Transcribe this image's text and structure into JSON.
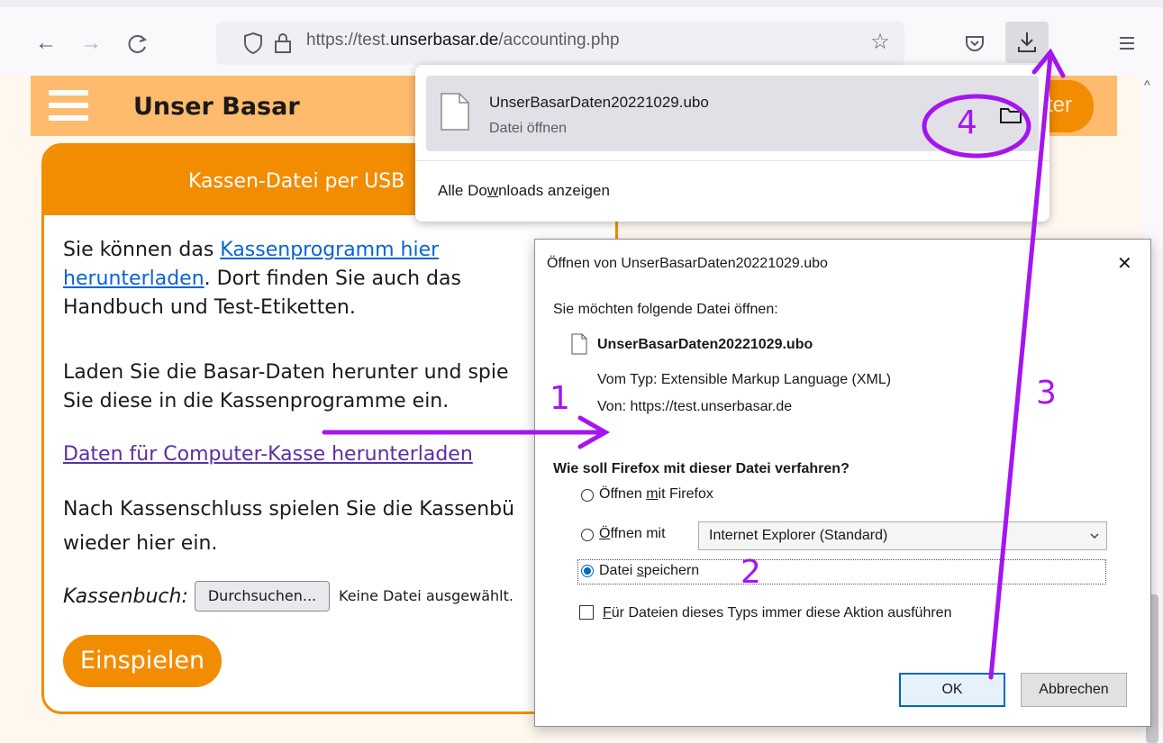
{
  "browser": {
    "url_prefix": "https://test.",
    "url_domain": "unserbasar.de",
    "url_path": "/accounting.php"
  },
  "site": {
    "title": "Unser Basar",
    "login_fragment": "ter"
  },
  "card": {
    "header": "Kassen-Datei per USB",
    "p1_a": "Sie können das ",
    "p1_link_a": "Kassenprogramm hier",
    "p1_link_b": "herunterladen",
    "p1_b": ". Dort finden Sie auch das",
    "p1_c": "Handbuch und Test-Etiketten.",
    "p2_a": "Laden Sie die Basar-Daten herunter und spie",
    "p2_b": "Sie diese in die Kassenprogramme ein.",
    "download_link": "Daten für Computer-Kasse herunterladen",
    "p3_a": "Nach Kassenschluss spielen Sie die Kassenbü",
    "p3_b": "wieder hier ein.",
    "kassenbuch_label": "Kassenbuch:",
    "browse_button": "Durchsuchen...",
    "no_file": "Keine Datei ausgewählt.",
    "import_button": "Einspielen"
  },
  "downloads_panel": {
    "filename": "UnserBasarDaten20221029.ubo",
    "status": "Datei öffnen",
    "show_all_a": "Alle Do",
    "show_all_u": "w",
    "show_all_b": "nloads anzeigen"
  },
  "dialog": {
    "title": "Öffnen von UnserBasarDaten20221029.ubo",
    "intro": "Sie möchten folgende Datei öffnen:",
    "filename": "UnserBasarDaten20221029.ubo",
    "type_label": "Vom Typ:",
    "type_value": "Extensible Markup Language (XML)",
    "from_label": "Von:",
    "from_value": "https://test.unserbasar.de",
    "question": "Wie soll Firefox mit dieser Datei verfahren?",
    "opt1_a": "Öffnen ",
    "opt1_u": "m",
    "opt1_b": "it Firefox",
    "opt2_u": "Ö",
    "opt2_b": "ffnen mit",
    "opt2_select": "Internet Explorer (Standard)",
    "opt3_a": "Datei ",
    "opt3_u": "s",
    "opt3_b": "peichern",
    "always_u": "F",
    "always_b": "ür Dateien dieses Typs immer diese Aktion ausführen",
    "ok": "OK",
    "cancel": "Abbrechen",
    "close_glyph": "✕"
  },
  "annotations": {
    "a1": "1",
    "a2": "2",
    "a3": "3",
    "a4": "4",
    "color": "#a415f0"
  },
  "icons": {
    "back": "back-arrow-icon",
    "forward": "forward-arrow-icon",
    "reload": "reload-icon",
    "shield": "tracking-shield-icon",
    "lock": "lock-icon",
    "star": "bookmark-star-icon",
    "pocket": "pocket-icon",
    "download": "download-icon",
    "menu": "hamburger-menu-icon",
    "folder": "folder-icon",
    "file": "file-icon"
  }
}
